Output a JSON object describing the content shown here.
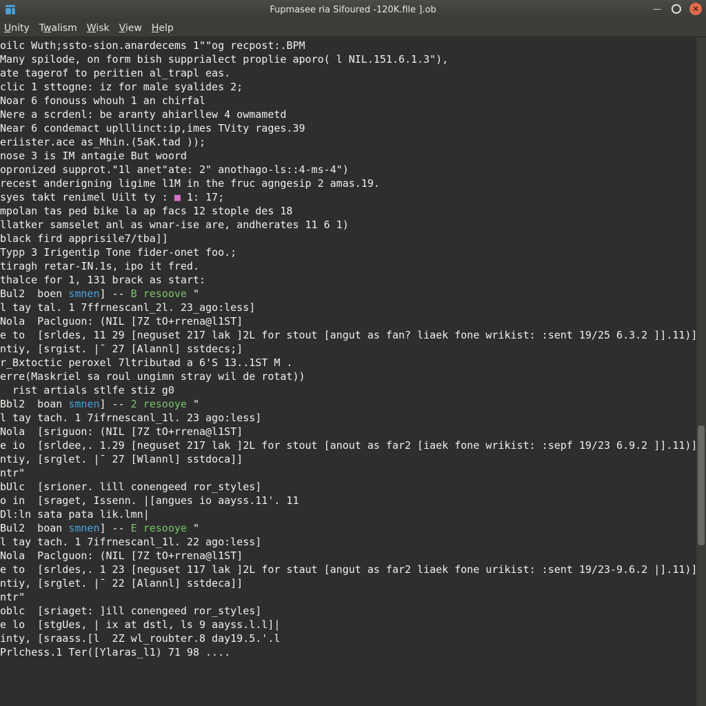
{
  "titlebar": {
    "title": "Fupmasee ria Sifoured -120K.file ].ob"
  },
  "menubar": {
    "items": [
      "Unity",
      "Twalism",
      "Wisk",
      "View",
      "Help"
    ],
    "underline_idx": [
      0,
      1,
      0,
      0,
      0
    ]
  },
  "terminal": {
    "lines": [
      [
        [
          "c-white",
          "oilc Wuth;ssto-sion.anardecems 1\"\"og recpost:.BPM"
        ]
      ],
      [
        [
          "c-white",
          "Many spilode, on form bish supprialect proplie aporo( l NIL.151.6.1.3\"),"
        ]
      ],
      [
        [
          "c-white",
          "ate tagerof to peritien al_trapl eas."
        ]
      ],
      [
        [
          "c-white",
          ""
        ]
      ],
      [
        [
          "c-white",
          "clic 1 sttogne: iz for male syalides 2;"
        ]
      ],
      [
        [
          "c-white",
          "Noar 6 fonouss whouh 1 an chirfal"
        ]
      ],
      [
        [
          "c-white",
          "Nere a scrdenl: be aranty ahiarllew 4 owmametd"
        ]
      ],
      [
        [
          "c-white",
          "Near 6 condemact uplllinct:ip,imes TVity rages.39"
        ]
      ],
      [
        [
          "c-white",
          "eriister.ace as_Mhin.(5aK.tad ));"
        ]
      ],
      [
        [
          "c-white",
          ""
        ]
      ],
      [
        [
          "c-white",
          "nose 3 is IM antagie But woord"
        ]
      ],
      [
        [
          "c-white",
          ""
        ]
      ],
      [
        [
          "c-white",
          "opronized supprot.\"1l anet\"ate: 2\" anothago-ls::4-ms-4\")"
        ]
      ],
      [
        [
          "c-white",
          "recest anderigning ligime l1M in the fruc agngesip 2 amas.19."
        ]
      ],
      [
        [
          "c-white",
          "syes takt renimel Uilt ty : "
        ],
        [
          "c-mag",
          "■"
        ],
        [
          "c-white",
          " 1: 17;"
        ]
      ],
      [
        [
          "c-white",
          "mpolan tas ped bike la ap facs 12 stople des 18"
        ]
      ],
      [
        [
          "c-white",
          "llatker samselet anl as wnar-ise are, andherates 11 6 1)"
        ]
      ],
      [
        [
          "c-white",
          ""
        ]
      ],
      [
        [
          "c-white",
          "black fird apprisile7/tba]]"
        ]
      ],
      [
        [
          "c-white",
          ""
        ]
      ],
      [
        [
          "c-white",
          "Typp 3 Irigentip Tone fider-onet foo.;"
        ]
      ],
      [
        [
          "c-white",
          ""
        ]
      ],
      [
        [
          "c-white",
          "tiragh retar-IN.1s, ipo it fred."
        ]
      ],
      [
        [
          "c-white",
          "thalce for 1, 131 brack as start:"
        ]
      ],
      [
        [
          "c-white",
          ""
        ]
      ],
      [
        [
          "c-white",
          "Bul2  boen "
        ],
        [
          "c-blue",
          "smnen"
        ],
        [
          "c-white",
          "] -- "
        ],
        [
          "c-green",
          "B"
        ],
        [
          "c-white",
          " "
        ],
        [
          "c-green",
          "resoove"
        ],
        [
          "c-white",
          " \""
        ]
      ],
      [
        [
          "c-white",
          "l tay tal. 1 7ffrnescanl_2l. 23_ago:less]"
        ]
      ],
      [
        [
          "c-white",
          "Nola  Paclguon: (NIL [7Z tO+rrena@l1ST]"
        ]
      ],
      [
        [
          "c-white",
          "e to  [srldes, 11 29 [neguset 217 lak ]2L for stout [angut as fan? liaek fone wrikist: :sent 19/25 6.3.2 ]].11)]"
        ]
      ],
      [
        [
          "c-white",
          "ntiy, [srgist. |¯ 27 [Alannl] sstdecs;]"
        ]
      ],
      [
        [
          "c-white",
          ""
        ]
      ],
      [
        [
          "c-white",
          "r_Bxtoctic peroxel 7ltributad a 6'S 13..1ST M ."
        ]
      ],
      [
        [
          "c-white",
          "erre(Maskriel sa roul ungimn stray wil de rotat))"
        ]
      ],
      [
        [
          "c-white",
          "  rist artials stlfe stiz g0"
        ]
      ],
      [
        [
          "c-white",
          "Bbl2  boan "
        ],
        [
          "c-blue",
          "smnen"
        ],
        [
          "c-white",
          "] -- "
        ],
        [
          "c-green",
          "2"
        ],
        [
          "c-white",
          " "
        ],
        [
          "c-green",
          "resooye"
        ],
        [
          "c-white",
          " \""
        ]
      ],
      [
        [
          "c-white",
          "l tay tach. 1 7ifrnescanl_1l. 23 ago:less]"
        ]
      ],
      [
        [
          "c-white",
          "Nola  [sriguon: (NIL [7Z tO+rrena@l1ST]"
        ]
      ],
      [
        [
          "c-white",
          "e io  [srldee,. 1.29 [neguset 217 lak ]2L for stout [anout as far2 [iaek fone wrikist: :sepf 19/23 6.9.2 ]].11)]"
        ]
      ],
      [
        [
          "c-white",
          "ntiy, [srglet. |¯ 27 [Wlannl] sstdoca]]"
        ]
      ],
      [
        [
          "c-white",
          "ntr\""
        ]
      ],
      [
        [
          "c-white",
          "bUlc  [srioner. lill conengeed ror_styles]"
        ]
      ],
      [
        [
          "c-white",
          "o in  [sraget, Issenn. |[angues io aayss.11'. 11"
        ]
      ],
      [
        [
          "c-white",
          "Dl:ln sata pata lik.lmn|"
        ]
      ],
      [
        [
          "c-white",
          ""
        ]
      ],
      [
        [
          "c-white",
          "Bul2  boan "
        ],
        [
          "c-blue",
          "smnen"
        ],
        [
          "c-white",
          "] -- "
        ],
        [
          "c-green",
          "E"
        ],
        [
          "c-white",
          " "
        ],
        [
          "c-green",
          "resooye"
        ],
        [
          "c-white",
          " \""
        ]
      ],
      [
        [
          "c-white",
          "l tay tach. 1 7ifrnescanl_1l. 22 ago:less]"
        ]
      ],
      [
        [
          "c-white",
          "Nola  Paclguon: (NIL [7Z tO+rrena@l1ST]"
        ]
      ],
      [
        [
          "c-white",
          "e to  [srldes,. 1 23 [neguset 117 lak ]2L for staut [angut as far2 liaek fone urikist: :sent 19/23-9.6.2 |].11)]"
        ]
      ],
      [
        [
          "c-white",
          "ntiy, [srglet. |¯ 22 [Alannl] sstdeca]]"
        ]
      ],
      [
        [
          "c-white",
          "ntr\""
        ]
      ],
      [
        [
          "c-white",
          "oblc  [sriaget: ]ill conengeed ror_styles]"
        ]
      ],
      [
        [
          "c-white",
          "e lo  [stgUes, | ix at dstl, ls 9 aayss.l.l]|"
        ]
      ],
      [
        [
          "c-white",
          "inty, [sraass.[l  2Z wl_roubter.8 day19.5.'.l"
        ]
      ],
      [
        [
          "c-white",
          ""
        ]
      ],
      [
        [
          "c-white",
          "Prlchess.1 Ter([Ylaras_l1) 71 98 ...."
        ]
      ]
    ]
  }
}
